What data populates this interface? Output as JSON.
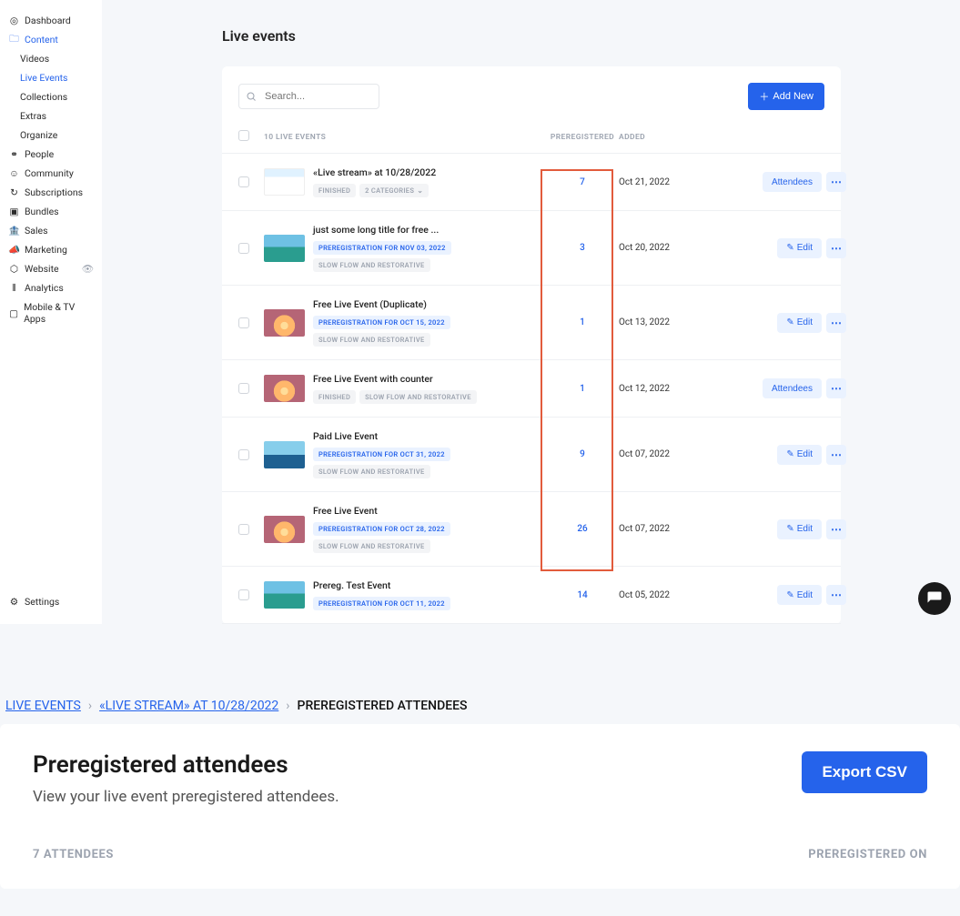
{
  "sidebar": {
    "items": [
      {
        "label": "Dashboard",
        "icon": "dashboard-icon"
      },
      {
        "label": "Content",
        "icon": "folder-icon",
        "active": true
      },
      {
        "label": "People",
        "icon": "people-icon"
      },
      {
        "label": "Community",
        "icon": "community-icon"
      },
      {
        "label": "Subscriptions",
        "icon": "subscriptions-icon"
      },
      {
        "label": "Bundles",
        "icon": "bundles-icon"
      },
      {
        "label": "Sales",
        "icon": "sales-icon"
      },
      {
        "label": "Marketing",
        "icon": "marketing-icon"
      },
      {
        "label": "Website",
        "icon": "website-icon"
      },
      {
        "label": "Analytics",
        "icon": "analytics-icon"
      },
      {
        "label": "Mobile & TV Apps",
        "icon": "devices-icon"
      }
    ],
    "content_sub": [
      {
        "label": "Videos"
      },
      {
        "label": "Live Events",
        "active": true
      },
      {
        "label": "Collections"
      },
      {
        "label": "Extras"
      },
      {
        "label": "Organize"
      }
    ],
    "settings_label": "Settings"
  },
  "page": {
    "title": "Live events",
    "search_placeholder": "Search...",
    "add_new_label": "Add New"
  },
  "table": {
    "count_label": "10 LIVE EVENTS",
    "col_prereg": "PREREGISTERED",
    "col_added": "ADDED",
    "edit_label": "Edit",
    "attendees_label": "Attendees"
  },
  "events": [
    {
      "title": "«Live stream» at 10/28/2022",
      "tags": [
        {
          "text": "FINISHED",
          "style": "gray"
        },
        {
          "text": "2 CATEGORIES",
          "style": "gray",
          "chev": true
        }
      ],
      "prereg": "7",
      "added": "Oct 21, 2022",
      "action": "attendees",
      "thumb": "ui"
    },
    {
      "title": "just some long title for free ...",
      "tags": [
        {
          "text": "PREREGISTRATION FOR NOV 03, 2022",
          "style": "blue"
        },
        {
          "text": "SLOW FLOW AND RESTORATIVE",
          "style": "gray"
        }
      ],
      "prereg": "3",
      "added": "Oct 20, 2022",
      "action": "edit",
      "thumb": "lake1"
    },
    {
      "title": "Free Live Event (Duplicate)",
      "tags": [
        {
          "text": "PREREGISTRATION FOR OCT 15, 2022",
          "style": "blue"
        },
        {
          "text": "SLOW FLOW AND RESTORATIVE",
          "style": "gray"
        }
      ],
      "prereg": "1",
      "added": "Oct 13, 2022",
      "action": "edit",
      "thumb": "sunset"
    },
    {
      "title": "Free Live Event with counter",
      "tags": [
        {
          "text": "FINISHED",
          "style": "gray"
        },
        {
          "text": "SLOW FLOW AND RESTORATIVE",
          "style": "gray"
        }
      ],
      "prereg": "1",
      "added": "Oct 12, 2022",
      "action": "attendees",
      "thumb": "sunset"
    },
    {
      "title": "Paid Live Event",
      "tags": [
        {
          "text": "PREREGISTRATION FOR OCT 31, 2022",
          "style": "blue"
        },
        {
          "text": "SLOW FLOW AND RESTORATIVE",
          "style": "gray"
        }
      ],
      "prereg": "9",
      "added": "Oct 07, 2022",
      "action": "edit",
      "thumb": "lake2"
    },
    {
      "title": "Free Live Event",
      "tags": [
        {
          "text": "PREREGISTRATION FOR OCT 28, 2022",
          "style": "blue"
        },
        {
          "text": "SLOW FLOW AND RESTORATIVE",
          "style": "gray"
        }
      ],
      "prereg": "26",
      "added": "Oct 07, 2022",
      "action": "edit",
      "thumb": "sunset"
    },
    {
      "title": "Prereg. Test Event",
      "tags": [
        {
          "text": "PREREGISTRATION FOR OCT 11, 2022",
          "style": "blue"
        }
      ],
      "prereg": "14",
      "added": "Oct 05, 2022",
      "action": "edit",
      "thumb": "lake1"
    }
  ],
  "attendees_page": {
    "crumbs": [
      "LIVE EVENTS",
      "«LIVE STREAM» AT 10/28/2022",
      "PREREGISTERED ATTENDEES"
    ],
    "heading": "Preregistered attendees",
    "subheading": "View your live event preregistered attendees.",
    "export_label": "Export CSV",
    "col_count": "7 ATTENDEES",
    "col_date": "PREREGISTERED ON"
  }
}
